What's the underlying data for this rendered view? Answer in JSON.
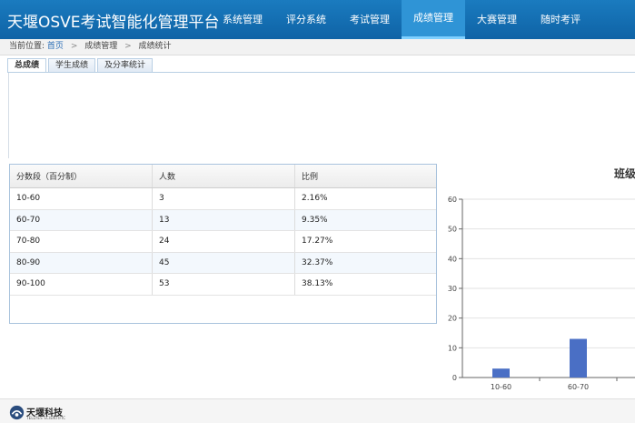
{
  "header": {
    "title": "天堰OSVE考试智能化管理平台",
    "nav": [
      "系统管理",
      "评分系统",
      "考试管理",
      "成绩管理",
      "大赛管理",
      "随时考评"
    ],
    "active_index": 3
  },
  "breadcrumb": {
    "prefix": "当前位置:",
    "items": [
      "首页",
      "成绩管理",
      "成绩统计"
    ]
  },
  "tabs": [
    "总成绩",
    "学生成绩",
    "及分率统计"
  ],
  "active_tab": 0,
  "table": {
    "columns": [
      "分数段（百分制）",
      "人数",
      "比例"
    ],
    "rows": [
      [
        "10-60",
        "3",
        "2.16%"
      ],
      [
        "60-70",
        "13",
        "9.35%"
      ],
      [
        "70-80",
        "24",
        "17.27%"
      ],
      [
        "80-90",
        "45",
        "32.37%"
      ],
      [
        "90-100",
        "53",
        "38.13%"
      ]
    ]
  },
  "chart_data": {
    "type": "bar",
    "title": "班级",
    "categories": [
      "10-60",
      "60-70"
    ],
    "values": [
      3,
      13
    ],
    "ylim": [
      0,
      60
    ],
    "yticks": [
      0,
      10,
      20,
      30,
      40,
      50,
      60
    ],
    "grid": true,
    "bar_color": "#4a6fc5"
  },
  "footer": {
    "logo_text": "天堰科技",
    "logo_sub": "TELLYES SCIENTIFIC"
  },
  "colors": {
    "header_bg": "#1a7bbf",
    "nav_active": "#2f94d6",
    "link": "#2a6db5"
  }
}
